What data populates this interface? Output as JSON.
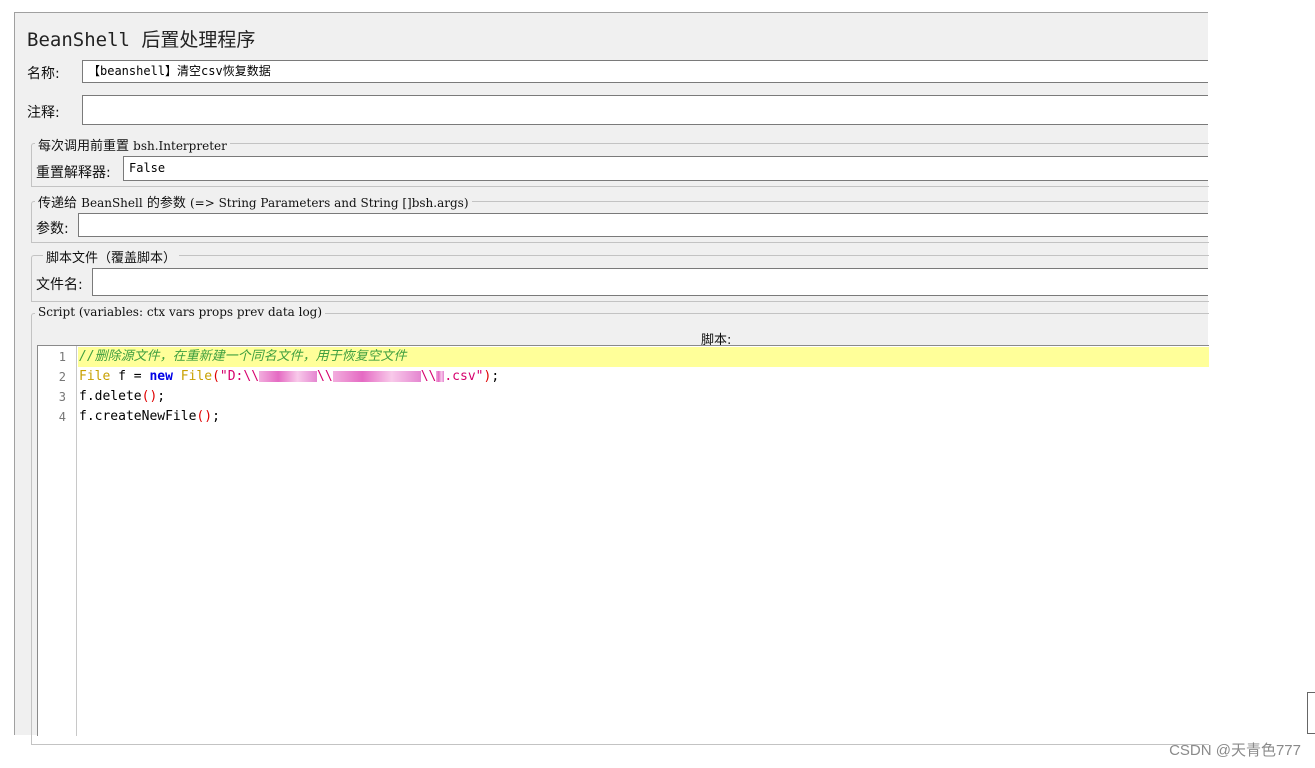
{
  "panel": {
    "title": "BeanShell 后置处理程序",
    "name_label": "名称:",
    "name_value": "【beanshell】清空csv恢复数据",
    "comment_label": "注释:",
    "comment_value": ""
  },
  "reset_group": {
    "legend_zh": "每次调用前重置",
    "legend_code": "bsh.Interpreter",
    "label": "重置解释器:",
    "value": "False"
  },
  "params_group": {
    "legend_zh": "传递给",
    "legend_code1": "BeanShell",
    "legend_zh2": "的参数",
    "legend_code2": "(=> String Parameters and String []bsh.args)",
    "label": "参数:",
    "value": ""
  },
  "file_group": {
    "legend": "脚本文件（覆盖脚本）",
    "label": "文件名:",
    "value": ""
  },
  "script_group": {
    "legend": "Script (variables: ctx vars props prev data log)",
    "header": "脚本:"
  },
  "code": {
    "line_numbers": [
      "1",
      "2",
      "3",
      "4"
    ],
    "line1": "//删除源文件，在重新建一个同名文件，用于恢复空文件",
    "line2_type": "File",
    "line2_var": " f = ",
    "line2_new": "new",
    "line2_ctor": " File",
    "line2_paren_open": "(",
    "line2_str_a": "\"D:\\\\",
    "line2_str_b": "\\\\",
    "line2_str_c": "\\\\",
    "line2_str_d": ".csv\"",
    "line2_paren_close": ")",
    "line2_end": ";",
    "line3_call": "f.delete",
    "line3_parens": "()",
    "line3_end": ";",
    "line4_call": "f.createNewFile",
    "line4_parens": "()",
    "line4_end": ";"
  },
  "watermark": "CSDN @天青色777"
}
